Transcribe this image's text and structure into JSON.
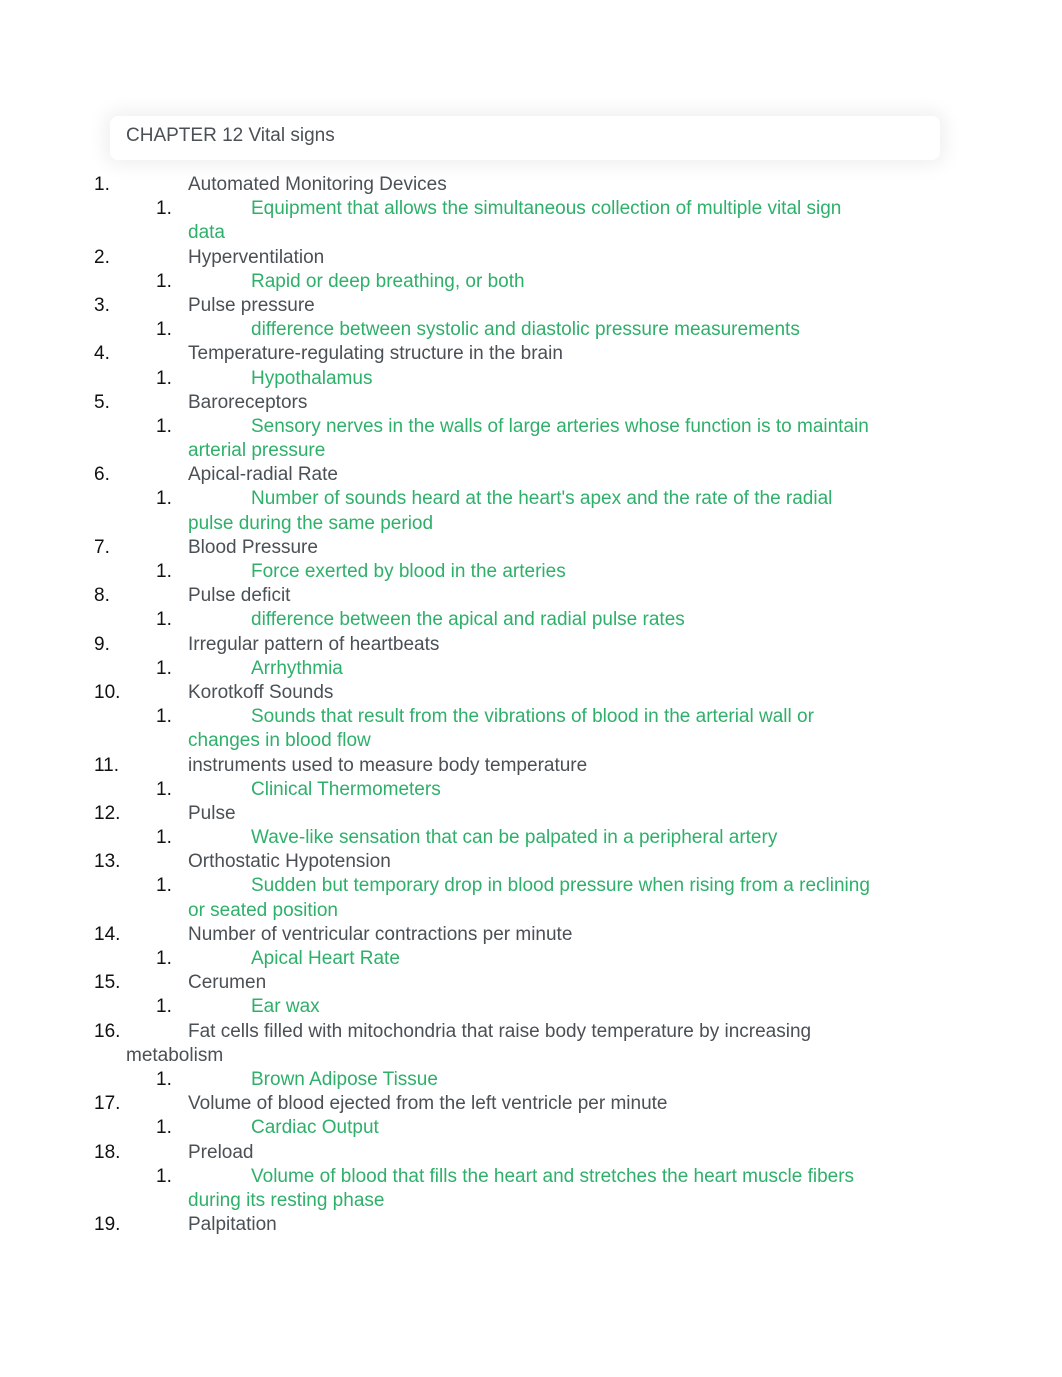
{
  "title": "CHAPTER 12 Vital signs",
  "items": [
    {
      "n": "1.",
      "term": [
        "Automated Monitoring Devices"
      ],
      "def": [
        "Equipment that allows the simultaneous collection of multiple vital sign",
        "data"
      ]
    },
    {
      "n": "2.",
      "term": [
        "Hyperventilation"
      ],
      "def": [
        "Rapid or deep breathing, or both"
      ]
    },
    {
      "n": "3.",
      "term": [
        "Pulse pressure"
      ],
      "def": [
        "difference between systolic and diastolic pressure measurements"
      ]
    },
    {
      "n": "4.",
      "term": [
        "Temperature-regulating structure in the brain"
      ],
      "def": [
        "Hypothalamus"
      ]
    },
    {
      "n": "5.",
      "term": [
        "Baroreceptors"
      ],
      "def": [
        "Sensory nerves in the walls of large arteries whose function is to maintain",
        "arterial pressure"
      ]
    },
    {
      "n": "6.",
      "term": [
        "Apical-radial Rate"
      ],
      "def": [
        "Number of sounds heard at the heart's apex and the rate of the radial",
        "pulse during the same period"
      ]
    },
    {
      "n": "7.",
      "term": [
        "Blood Pressure"
      ],
      "def": [
        "Force exerted by blood in the arteries"
      ]
    },
    {
      "n": "8.",
      "term": [
        "Pulse deficit"
      ],
      "def": [
        "difference between the apical and radial pulse rates"
      ]
    },
    {
      "n": "9.",
      "term": [
        "Irregular pattern of heartbeats"
      ],
      "def": [
        "Arrhythmia"
      ]
    },
    {
      "n": "10.",
      "term": [
        "Korotkoff Sounds"
      ],
      "def": [
        "Sounds that result from the vibrations of blood in the arterial wall or",
        "changes in blood flow"
      ]
    },
    {
      "n": "11.",
      "term": [
        "instruments used to measure body temperature"
      ],
      "def": [
        "Clinical Thermometers"
      ]
    },
    {
      "n": "12.",
      "term": [
        "Pulse"
      ],
      "def": [
        "Wave-like sensation that can be palpated in a peripheral artery"
      ]
    },
    {
      "n": "13.",
      "term": [
        "Orthostatic Hypotension"
      ],
      "def": [
        "Sudden but temporary drop in blood pressure when rising from a reclining",
        "or seated position"
      ]
    },
    {
      "n": "14.",
      "term": [
        "Number of ventricular contractions per minute"
      ],
      "def": [
        "Apical Heart Rate"
      ]
    },
    {
      "n": "15.",
      "term": [
        "Cerumen"
      ],
      "def": [
        "Ear wax"
      ]
    },
    {
      "n": "16.",
      "term": [
        "Fat cells filled with mitochondria that raise body temperature by increasing",
        "metabolism"
      ],
      "def": [
        "Brown Adipose Tissue"
      ]
    },
    {
      "n": "17.",
      "term": [
        "Volume of blood ejected from the left ventricle per minute"
      ],
      "def": [
        "Cardiac Output"
      ]
    },
    {
      "n": "18.",
      "term": [
        "Preload"
      ],
      "def": [
        "Volume of blood that fills the heart and stretches the heart muscle fibers",
        "during its resting phase"
      ]
    },
    {
      "n": "19.",
      "term": [
        "Palpitation"
      ],
      "def": []
    }
  ],
  "sub_number": "1."
}
